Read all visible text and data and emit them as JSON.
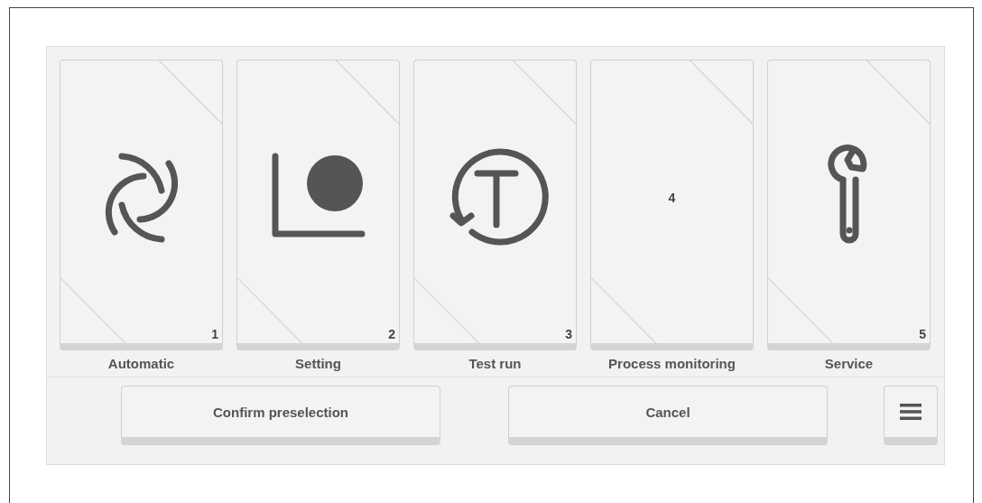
{
  "tiles": [
    {
      "label": "Automatic",
      "number": "1",
      "kind": "swirl"
    },
    {
      "label": "Setting",
      "number": "2",
      "kind": "corner-dot"
    },
    {
      "label": "Test run",
      "number": "3",
      "kind": "test-run"
    },
    {
      "label": "Process monitoring",
      "number": "4",
      "kind": "blank"
    },
    {
      "label": "Service",
      "number": "5",
      "kind": "wrench"
    }
  ],
  "buttons": [
    "Confirm preselection",
    "Cancel"
  ]
}
